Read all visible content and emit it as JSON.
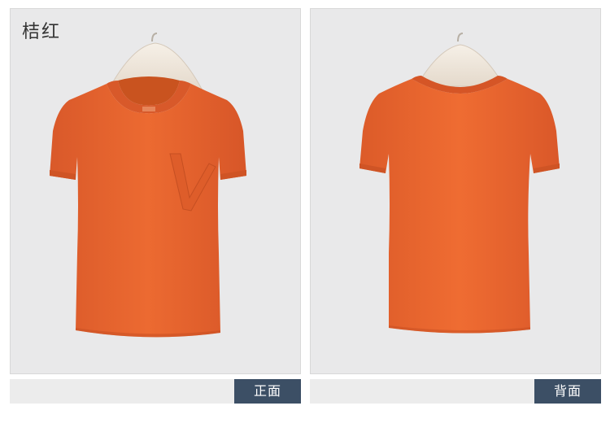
{
  "color_name": "桔红",
  "views": {
    "front_label": "正面",
    "back_label": "背面"
  },
  "garment": {
    "body_color": "#e8662e",
    "trim_color": "#de5d2a",
    "hanger_color": "#f1e9df"
  },
  "colors": {
    "panel_background": "#e9e9ea",
    "caption_bar": "#ececec",
    "caption_tag": "#3c4f65"
  }
}
